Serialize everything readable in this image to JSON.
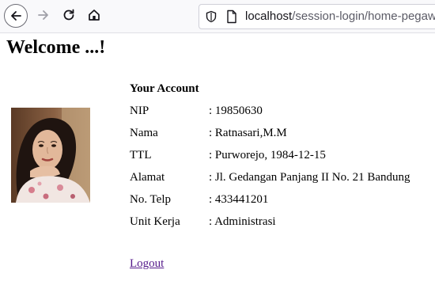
{
  "browser": {
    "url_host": "localhost",
    "url_path": "/session-login/home-pegawai.p"
  },
  "page": {
    "welcome": "Welcome ...!",
    "account_heading": "Your Account",
    "fields": [
      {
        "label": "NIP",
        "value": ": 19850630"
      },
      {
        "label": "Nama",
        "value": ": Ratnasari,M.M"
      },
      {
        "label": "TTL",
        "value": ": Purworejo, 1984-12-15"
      },
      {
        "label": "Alamat",
        "value": ": Jl. Gedangan Panjang II No. 21 Bandung"
      },
      {
        "label": "No. Telp",
        "value": ": 433441201"
      },
      {
        "label": "Unit Kerja",
        "value": ": Administrasi"
      }
    ],
    "logout": "Logout"
  }
}
